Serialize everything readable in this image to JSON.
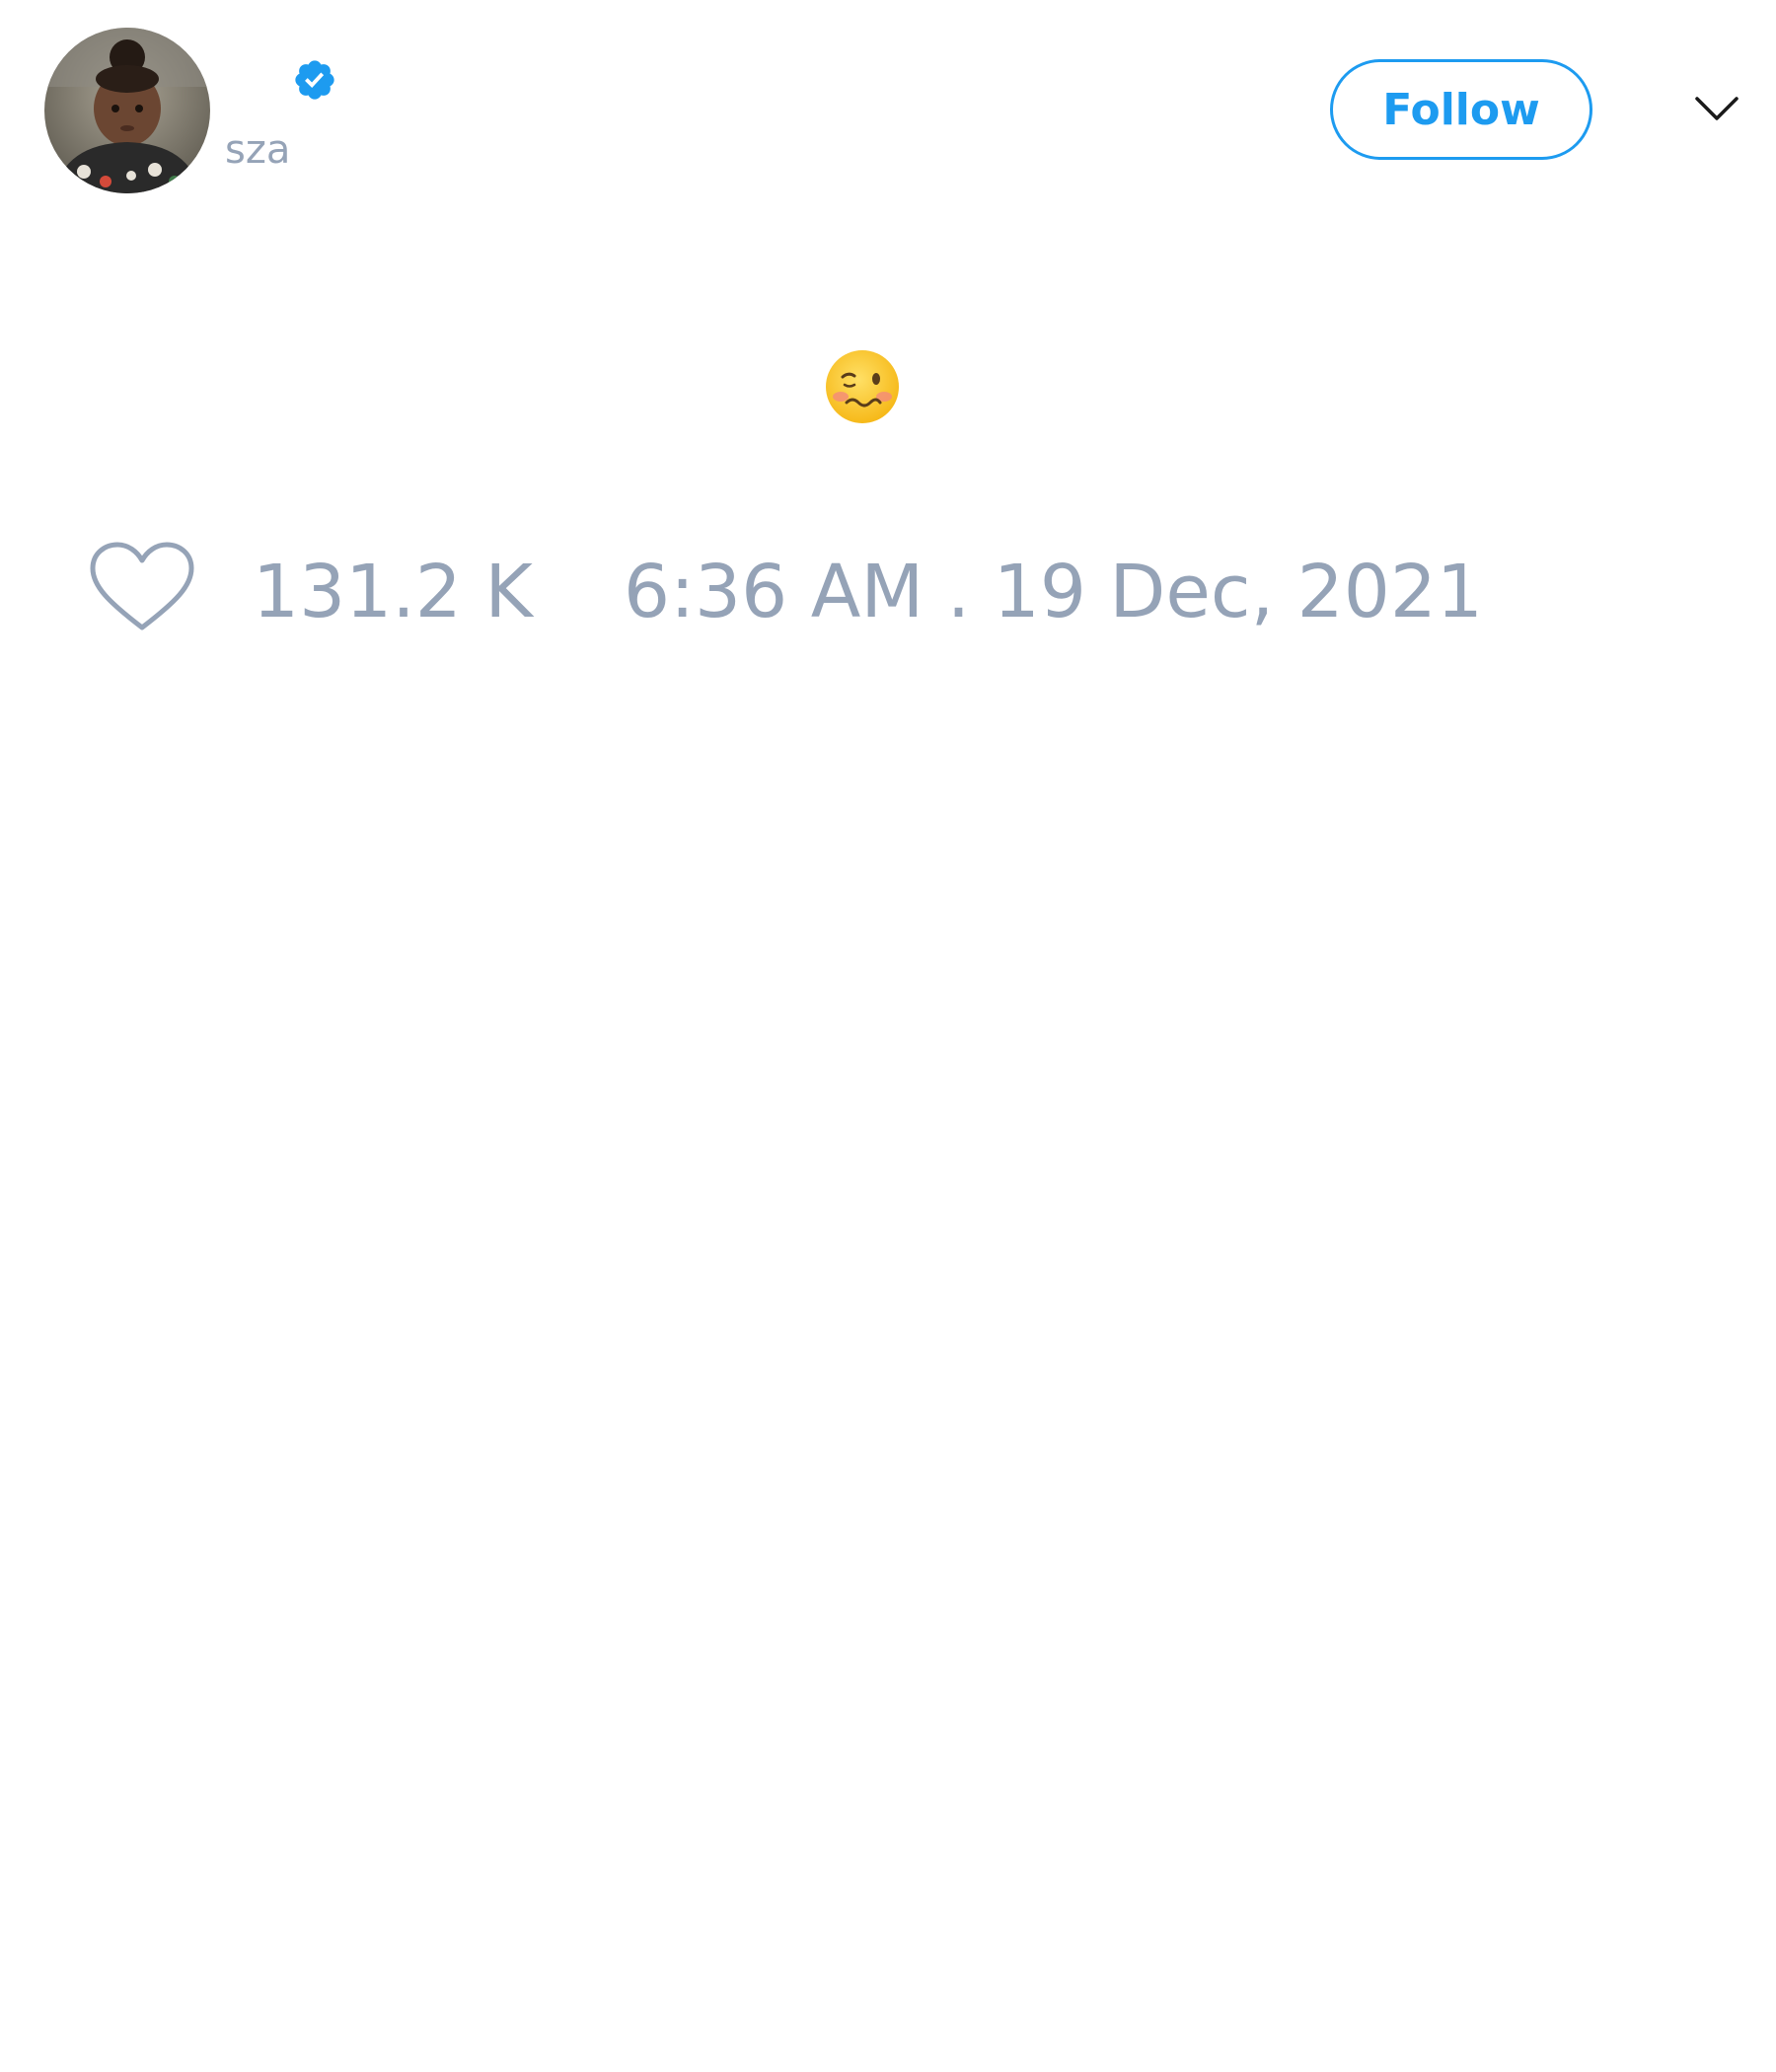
{
  "profile": {
    "handle": "sza",
    "verified": true
  },
  "actions": {
    "follow_label": "Follow"
  },
  "tweet": {
    "content": "🥴",
    "likes": "131.2 K",
    "timestamp": "6:36 AM . 19 Dec, 2021"
  },
  "colors": {
    "accent": "#1d9bf0",
    "muted_text": "#95a3b7",
    "background": "#ffffff"
  },
  "icons": {
    "verified": "verified-badge-icon",
    "menu": "chevron-down-icon",
    "like": "heart-outline-icon",
    "content": "woozy-face-emoji"
  }
}
